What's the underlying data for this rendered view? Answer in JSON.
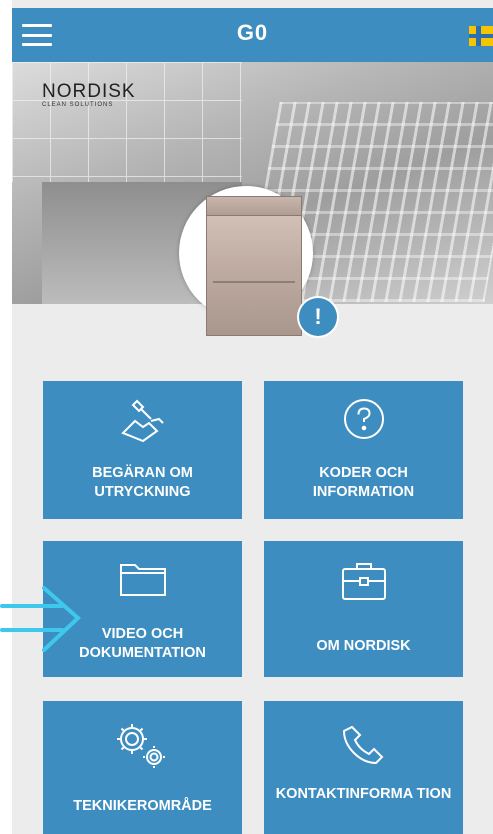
{
  "header": {
    "title": "G0",
    "flag": "swedish-flag-icon"
  },
  "logo": {
    "name": "NORDISK",
    "tagline": "CLEAN SOLUTIONS"
  },
  "alert_badge": "!",
  "tiles": [
    {
      "label": "BEGÄRAN OM UTRYCKNING",
      "icon": "wrench-hand-icon"
    },
    {
      "label": "KODER OCH INFORMATION",
      "icon": "question-circle-icon"
    },
    {
      "label": "VIDEO OCH DOKUMENTATION",
      "icon": "folder-icon"
    },
    {
      "label": "OM NORDISK",
      "icon": "briefcase-icon"
    },
    {
      "label": "TEKNIKEROMRÅDE",
      "icon": "gears-icon"
    },
    {
      "label": "KONTAKTINFORMA TION",
      "icon": "phone-icon"
    }
  ],
  "colors": {
    "accent": "#3e8dc1",
    "background": "#ececec",
    "pointer_arrow": "#3ec8ee"
  }
}
